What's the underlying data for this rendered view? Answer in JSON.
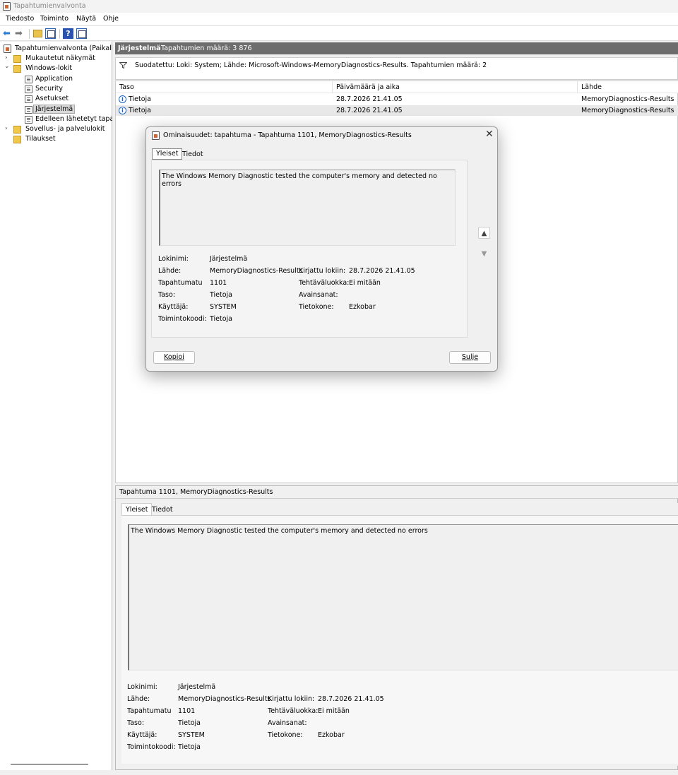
{
  "window": {
    "title": "Tapahtumienvalvonta"
  },
  "menu": [
    "Tiedosto",
    "Toiminto",
    "Näytä",
    "Ohje"
  ],
  "toolbar": {
    "icons": [
      "back-arrow-icon",
      "forward-arrow-icon",
      "up-folder-icon",
      "show-hide-tree-icon",
      "help-icon",
      "show-hide-action-pane-icon"
    ]
  },
  "tree": {
    "items": [
      {
        "label": "Tapahtumienvalvonta (Paikallinen)",
        "level": 0,
        "chevron": "",
        "icon": "app-icon"
      },
      {
        "label": "Mukautetut näkymät",
        "level": 1,
        "chevron": "›",
        "icon": "folder-icon"
      },
      {
        "label": "Windows-lokit",
        "level": 1,
        "chevron": "⌄",
        "icon": "folder-icon"
      },
      {
        "label": "Application",
        "level": 2,
        "chevron": "",
        "icon": "log-icon"
      },
      {
        "label": "Security",
        "level": 2,
        "chevron": "",
        "icon": "log-icon"
      },
      {
        "label": "Asetukset",
        "level": 2,
        "chevron": "",
        "icon": "log-icon"
      },
      {
        "label": "Järjestelmä",
        "level": 2,
        "chevron": "",
        "icon": "log-icon",
        "selected": true
      },
      {
        "label": "Edelleen lähetetyt tapahtumat",
        "level": 2,
        "chevron": "",
        "icon": "log-icon"
      },
      {
        "label": "Sovellus- ja palvelulokit",
        "level": 1,
        "chevron": "›",
        "icon": "folder-icon"
      },
      {
        "label": "Tilaukset",
        "level": 1,
        "chevron": "",
        "icon": "folder-icon"
      }
    ]
  },
  "header": {
    "log_name": "Järjestelmä",
    "count_label": "Tapahtumien määrä: 3 876"
  },
  "filter": {
    "text": "Suodatettu: Loki: System; Lähde: Microsoft-Windows-MemoryDiagnostics-Results. Tapahtumien määrä: 2"
  },
  "table": {
    "columns": [
      "Taso",
      "Päivämäärä ja aika",
      "Lähde"
    ],
    "rows": [
      {
        "level": "Tietoja",
        "datetime": "28.7.2026 21.41.05",
        "source": "MemoryDiagnostics-Results"
      },
      {
        "level": "Tietoja",
        "datetime": "28.7.2026 21.41.05",
        "source": "MemoryDiagnostics-Results"
      }
    ]
  },
  "dialog": {
    "title": "Ominaisuudet: tapahtuma - Tapahtuma 1101, MemoryDiagnostics-Results",
    "tabs": [
      "Yleiset",
      "Tiedot"
    ],
    "message": "The Windows Memory Diagnostic tested the computer's memory and detected no errors",
    "fields": {
      "log_name_label": "Lokinimi:",
      "log_name": "Järjestelmä",
      "source_label": "Lähde:",
      "source": "MemoryDiagnostics-Results",
      "event_id_label": "Tapahtumatu",
      "event_id": "1101",
      "level_label": "Taso:",
      "level": "Tietoja",
      "user_label": "Käyttäjä:",
      "user": "SYSTEM",
      "opcode_label": "Toimintokoodi:",
      "opcode": "Tietoja",
      "logged_label": "Kirjattu lokiin:",
      "logged": "28.7.2026 21.41.05",
      "task_label": "Tehtäväluokka:",
      "task": "Ei mitään",
      "keywords_label": "Avainsanat:",
      "keywords": "",
      "computer_label": "Tietokone:",
      "computer": "Ezkobar"
    },
    "copy_button": "Kopioi",
    "close_button": "Sulje"
  },
  "preview": {
    "title": "Tapahtuma 1101, MemoryDiagnostics-Results",
    "tabs": [
      "Yleiset",
      "Tiedot"
    ],
    "message": "The Windows Memory Diagnostic tested the computer's memory and detected no errors",
    "fields": {
      "log_name_label": "Lokinimi:",
      "log_name": "Järjestelmä",
      "source_label": "Lähde:",
      "source": "MemoryDiagnostics-Results",
      "event_id_label": "Tapahtumatu",
      "event_id": "1101",
      "level_label": "Taso:",
      "level": "Tietoja",
      "user_label": "Käyttäjä:",
      "user": "SYSTEM",
      "opcode_label": "Toimintokoodi:",
      "opcode": "Tietoja",
      "logged_label": "Kirjattu lokiin:",
      "logged": "28.7.2026 21.41.05",
      "task_label": "Tehtäväluokka:",
      "task": "Ei mitään",
      "keywords_label": "Avainsanat:",
      "keywords": "",
      "computer_label": "Tietokone:",
      "computer": "Ezkobar"
    }
  }
}
